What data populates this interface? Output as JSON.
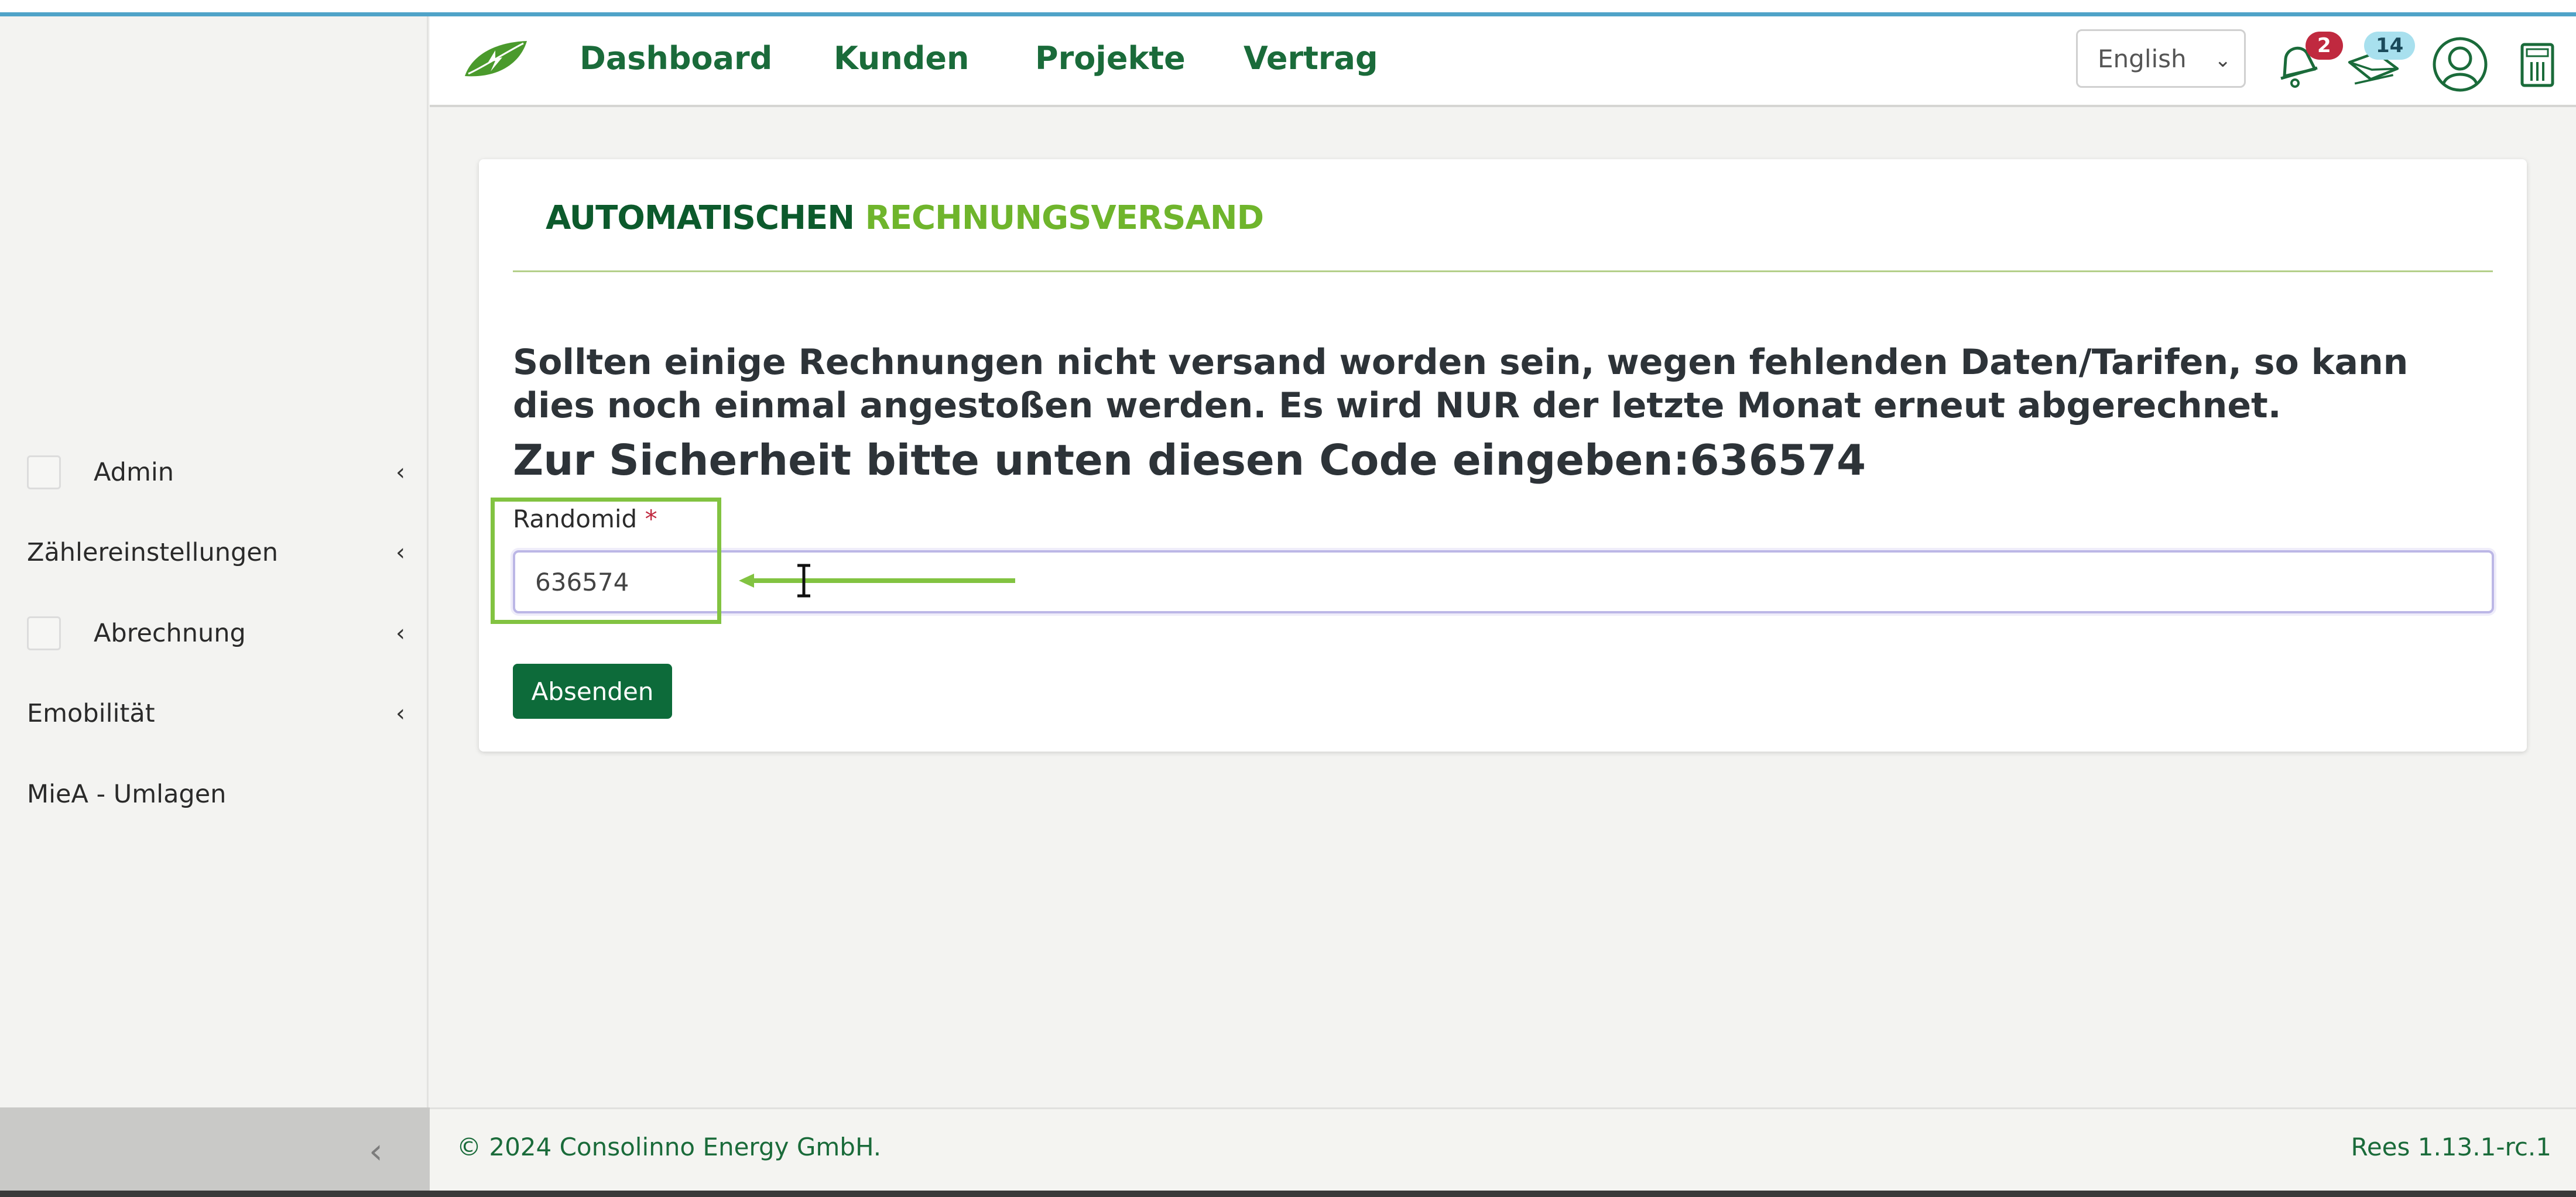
{
  "header": {
    "nav": [
      "Dashboard",
      "Kunden",
      "Projekte",
      "Vertrag"
    ],
    "language": "English",
    "notifications_count": "2",
    "messages_count": "14"
  },
  "sidebar": {
    "items": [
      {
        "label": "Admin",
        "chevron": "‹"
      },
      {
        "label": "Zählereinstellungen",
        "chevron": "‹"
      },
      {
        "label": "Abrechnung",
        "chevron": "‹"
      },
      {
        "label": "Emobilität",
        "chevron": "‹"
      },
      {
        "label": "MieA - Umlagen",
        "chevron": ""
      }
    ],
    "collapse_glyph": "‹"
  },
  "card": {
    "title_part1": "AUTOMATISCHEN",
    "title_part2": "RECHNUNGSVERSAND",
    "info": "Sollten einige Rechnungen nicht versand worden sein, wegen fehlenden Daten/Tarifen, so kann dies noch einmal angestoßen werden. Es wird NUR der letzte Monat erneut abgerechnet.",
    "code_line": "Zur Sicherheit bitte unten diesen Code eingeben:636574",
    "field_label": "Randomid",
    "field_required": "*",
    "field_value": "636574",
    "submit_label": "Absenden"
  },
  "footer": {
    "copyright": "© 2024 Consolinno Energy GmbH.",
    "version": "Rees 1.13.1-rc.1"
  },
  "colors": {
    "brand_dark_green": "#0c5a2c",
    "brand_light_green": "#6fb52c",
    "highlight_green": "#82c341",
    "badge_red": "#c0293f",
    "badge_cyan": "#a8e0ee"
  }
}
